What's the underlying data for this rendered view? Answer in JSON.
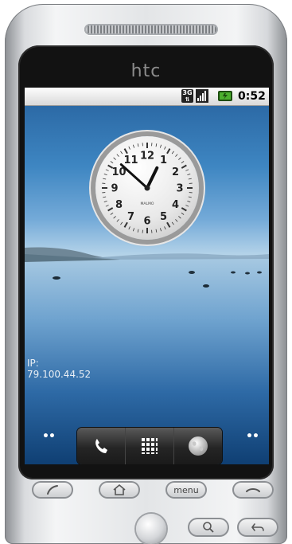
{
  "device": {
    "brand": "htc"
  },
  "statusbar": {
    "network": "3G",
    "time": "0:52",
    "icons": [
      "3g-icon",
      "signal-icon",
      "battery-charging-icon"
    ]
  },
  "clock_widget": {
    "brand_text": "MALMO",
    "numerals": [
      "12",
      "1",
      "2",
      "3",
      "4",
      "5",
      "6",
      "7",
      "8",
      "9",
      "10",
      "11"
    ],
    "time_shown": "12:52"
  },
  "ip_widget": {
    "label": "IP:",
    "value": "79.100.44.52"
  },
  "dock": {
    "items": [
      "phone-icon",
      "apps-grid-icon",
      "browser-globe-icon"
    ]
  },
  "hardware_buttons": {
    "call": "call-icon",
    "home": "home-icon",
    "menu_label": "menu",
    "end_call": "end-call-icon",
    "search": "search-icon",
    "back": "back-icon"
  },
  "colors": {
    "sky": "#3e86c2",
    "water": "#2e6aa6",
    "battery": "#4caf2f"
  }
}
